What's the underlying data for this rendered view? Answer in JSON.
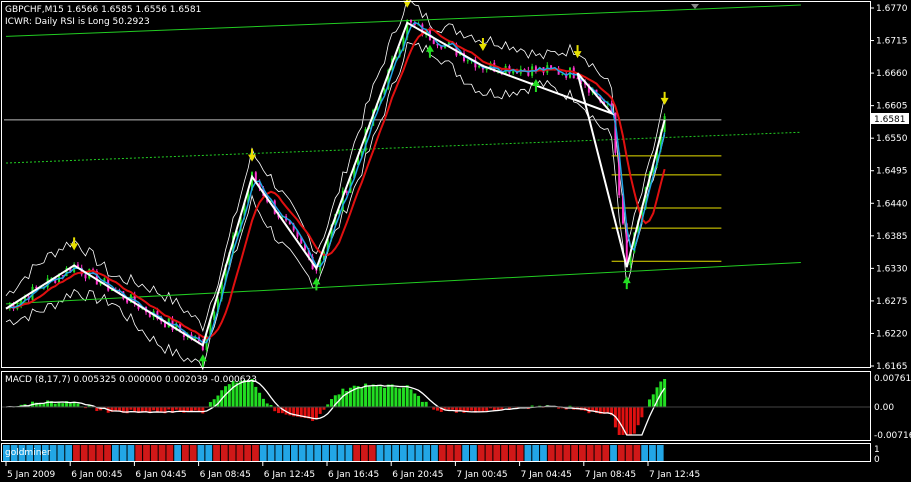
{
  "header": {
    "symbol_line": "GBPCHF,M15  1.6566 1.6585 1.6556 1.6581",
    "indicator_line": "ICWR: Daily RSI is Long 50.2923"
  },
  "macd": {
    "label": "MACD (8,17,7) 0.005325 0.000000 0.002039 -0.000623",
    "ticks": [
      "0.007611",
      "0.00",
      "-0.00716"
    ]
  },
  "goldminer": {
    "label": "goldminer",
    "right_tick": "1",
    "right_tick_zero": "0",
    "segments": [
      {
        "color": "#22a6e6",
        "n": 9
      },
      {
        "color": "#d01818",
        "n": 5
      },
      {
        "color": "#22a6e6",
        "n": 3
      },
      {
        "color": "#d01818",
        "n": 5
      },
      {
        "color": "#22a6e6",
        "n": 1
      },
      {
        "color": "#d01818",
        "n": 2
      },
      {
        "color": "#22a6e6",
        "n": 2
      },
      {
        "color": "#d01818",
        "n": 6
      },
      {
        "color": "#22a6e6",
        "n": 12
      },
      {
        "color": "#d01818",
        "n": 3
      },
      {
        "color": "#22a6e6",
        "n": 8
      },
      {
        "color": "#d01818",
        "n": 3
      },
      {
        "color": "#22a6e6",
        "n": 2
      },
      {
        "color": "#d01818",
        "n": 6
      },
      {
        "color": "#22a6e6",
        "n": 3
      },
      {
        "color": "#d01818",
        "n": 8
      },
      {
        "color": "#22a6e6",
        "n": 1
      },
      {
        "color": "#d01818",
        "n": 3
      },
      {
        "color": "#22a6e6",
        "n": 3
      }
    ]
  },
  "colors": {
    "background": "#000000",
    "axis": "#ffffff",
    "grid_green": "#22cc22",
    "bull_candle": "#22dd22",
    "bear_candle": "#ff33cc",
    "red_ma": "#e01010",
    "blue_ma": "#22a6e6",
    "zigzag": "#ffffff",
    "envelope": "#ffffff",
    "fib_yellow": "#e8e000",
    "macd_pos": "#22dd22",
    "macd_neg": "#e01010"
  },
  "chart_data": {
    "type": "candlestick",
    "symbol": "GBPCHF",
    "timeframe": "M15",
    "y_ticks": [
      "1.6770",
      "1.6715",
      "1.6660",
      "1.6605",
      "1.6550",
      "1.6495",
      "1.6440",
      "1.6385",
      "1.6330",
      "1.6275",
      "1.6220",
      "1.6165"
    ],
    "ylim": [
      1.6165,
      1.677
    ],
    "current_price": "1.6581",
    "x_ticks": [
      "5 Jan 2009",
      "6 Jan 00:45",
      "6 Jan 04:45",
      "6 Jan 08:45",
      "6 Jan 12:45",
      "6 Jan 16:45",
      "6 Jan 20:45",
      "7 Jan 00:45",
      "7 Jan 04:45",
      "7 Jan 08:45",
      "7 Jan 12:45"
    ],
    "zigzag": [
      {
        "t": 0,
        "p": 1.6262
      },
      {
        "t": 18,
        "p": 1.6335
      },
      {
        "t": 52,
        "p": 1.62
      },
      {
        "t": 65,
        "p": 1.6485
      },
      {
        "t": 82,
        "p": 1.633
      },
      {
        "t": 106,
        "p": 1.6745
      },
      {
        "t": 126,
        "p": 1.6672
      },
      {
        "t": 160,
        "p": 1.6592
      },
      {
        "t": 151,
        "p": 1.666
      },
      {
        "t": 164,
        "p": 1.6332
      },
      {
        "t": 174,
        "p": 1.6581
      }
    ],
    "fib_levels": [
      1.6581,
      1.652,
      1.6488,
      1.6432,
      1.6398,
      1.6342
    ],
    "trend_lines": [
      {
        "from": [
          0,
          1.6722
        ],
        "to": [
          210,
          1.6775
        ],
        "style": "solid"
      },
      {
        "from": [
          0,
          1.6508
        ],
        "to": [
          210,
          1.656
        ],
        "style": "dashed"
      },
      {
        "from": [
          0,
          1.627
        ],
        "to": [
          210,
          1.634
        ],
        "style": "solid"
      }
    ]
  }
}
